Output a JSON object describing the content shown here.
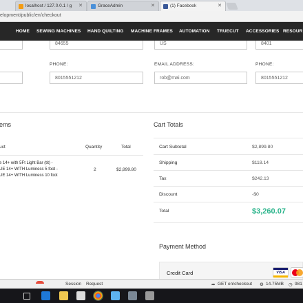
{
  "browser": {
    "tabs": [
      {
        "title": "localhost / 127.0.0.1 / g"
      },
      {
        "title": "GraceAdmin"
      },
      {
        "title": "(1) Facebook"
      }
    ],
    "url": "elopment/public/en/checkout"
  },
  "nav": {
    "items": [
      "HOME",
      "SEWING MACHINES",
      "HAND QUILTING",
      "MACHINE FRAMES",
      "AUTOMATION",
      "TRUECUT",
      "ACCESSORIES",
      "RESOUR"
    ]
  },
  "billing": {
    "postal_code": "84655",
    "country": "US",
    "postal_code_2": "8401",
    "phone_label": "PHONE:",
    "phone": "8015551212",
    "email_label": "EMAIL ADDRESS:",
    "email": "rob@mai.com",
    "phone_label_2": "PHONE:",
    "phone_2": "8015551212"
  },
  "items": {
    "title": "ems",
    "col_product": "uct",
    "col_quantity": "Quantity",
    "col_total": "Total",
    "rows": [
      {
        "lines": [
          "e 14+ with 5Ft Light Bar (tit) -",
          "UE 14+ WITH Luminess 5 foot -",
          "UE 14+ WITH Luminess 10 foot"
        ],
        "quantity": "2",
        "total": "$2,899.80"
      }
    ]
  },
  "totals": {
    "title": "Cart Totals",
    "rows": [
      {
        "label": "Cart Subtotal",
        "value": "$2,899.80"
      },
      {
        "label": "Shipping",
        "value": "$118.14"
      },
      {
        "label": "Tax",
        "value": "$242.13"
      },
      {
        "label": "Discount",
        "value": "-$0"
      }
    ],
    "total_label": "Total",
    "total_value": "$3,260.07"
  },
  "payment": {
    "title": "Payment Method",
    "option": "Credit Card",
    "card_brands": [
      "VISA",
      "MASTERCARD"
    ]
  },
  "debugbar": {
    "session": "Session",
    "request": "Request",
    "route": "GET en/checkout",
    "memory": "14.75MB",
    "time": "981"
  },
  "colors": {
    "accent_total": "#28b38a",
    "nav_bg": "#272727"
  }
}
